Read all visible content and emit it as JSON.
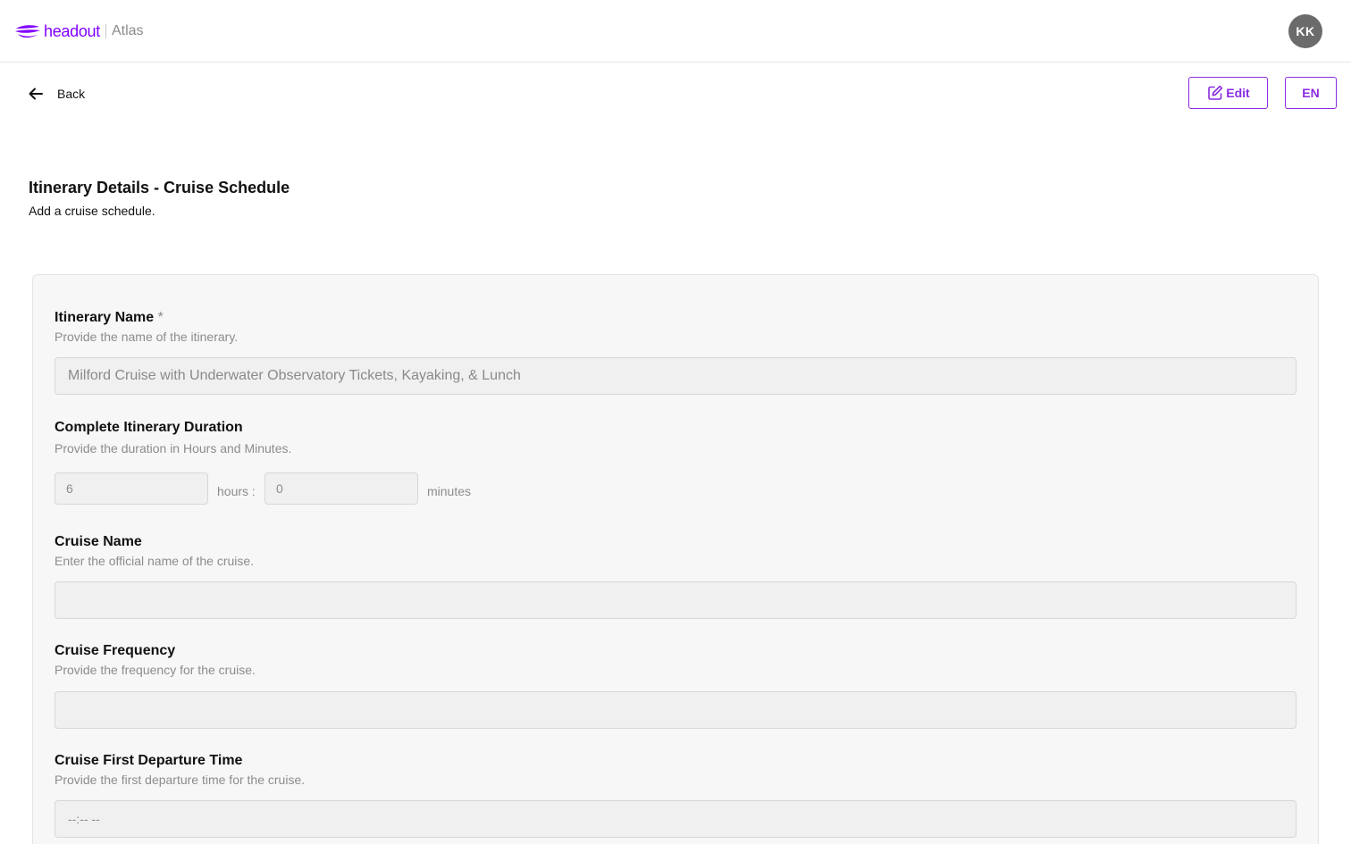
{
  "header": {
    "brand_name": "headout",
    "product_name": "Atlas",
    "avatar_initials": "KK",
    "brand_color": "#8000ff"
  },
  "toolbar": {
    "back_label": "Back",
    "edit_label": "Edit",
    "language_label": "EN"
  },
  "page": {
    "title": "Itinerary Details - Cruise Schedule",
    "subtitle": "Add a cruise schedule."
  },
  "form": {
    "itinerary_name": {
      "label": "Itinerary Name",
      "required_mark": "*",
      "help": "Provide the name of the itinerary.",
      "value": "Milford Cruise with Underwater Observatory Tickets, Kayaking, & Lunch"
    },
    "duration": {
      "label": "Complete Itinerary Duration",
      "help": "Provide the duration in Hours and Minutes.",
      "hours_value": "6",
      "hours_unit": "hours :",
      "minutes_value": "0",
      "minutes_unit": "minutes"
    },
    "cruise_name": {
      "label": "Cruise Name",
      "help": "Enter the official name of the cruise.",
      "value": ""
    },
    "cruise_frequency": {
      "label": "Cruise Frequency",
      "help": "Provide the frequency for the cruise.",
      "value": ""
    },
    "first_departure": {
      "label": "Cruise First Departure Time",
      "help": "Provide the first departure time for the cruise.",
      "value": "--:-- --"
    }
  }
}
